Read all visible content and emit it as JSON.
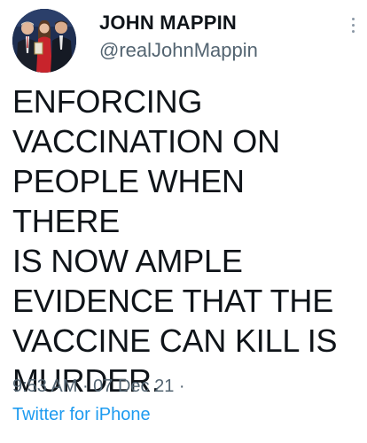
{
  "tweet": {
    "display_name": "JOHN MAPPIN",
    "handle": "@realJohnMappin",
    "text": "ENFORCING\nVACCINATION ON\nPEOPLE WHEN THERE\nIS NOW AMPLE\nEVIDENCE THAT THE\nVACCINE CAN KILL IS\nMURDER.",
    "time": "9:53 AM",
    "date": "07 Dec 21",
    "source": "Twitter for iPhone",
    "more_icon": "more-vertical-icon",
    "colors": {
      "link": "#1d9bf0",
      "secondary": "#536471",
      "text": "#0f1419"
    }
  }
}
